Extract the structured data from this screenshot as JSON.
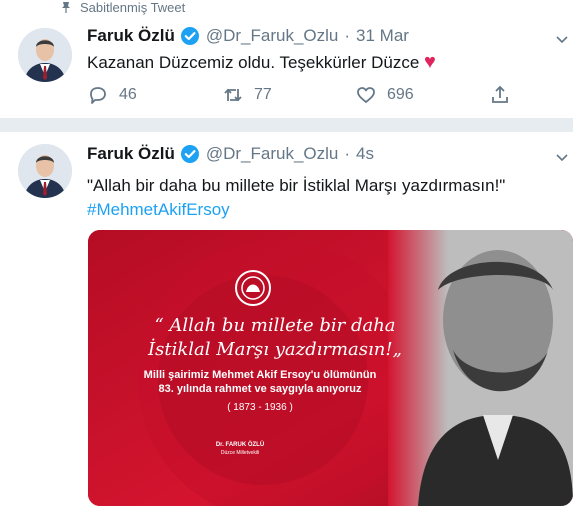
{
  "pinned": {
    "label": "Sabitlenmiş Tweet",
    "icon": "pin-icon"
  },
  "tweets": [
    {
      "name": "Faruk Özlü",
      "handle": "@Dr_Faruk_Ozlu",
      "separator": "·",
      "time": "31 Mar",
      "text": "Kazanan Düzcemiz oldu. Teşekkürler Düzce",
      "emoji": "♥",
      "replies": "46",
      "retweets": "77",
      "likes": "696"
    },
    {
      "name": "Faruk Özlü",
      "handle": "@Dr_Faruk_Ozlu",
      "separator": "·",
      "time": "4s",
      "text_line1": "\"Allah bir daha bu millete bir İstiklal Marşı yazdırmasın!\"",
      "hashtag": "#MehmetAkifErsoy",
      "media": {
        "quote_line1": "“ Allah bu millete bir daha",
        "quote_line2": "İstiklal Marşı yazdırmasın!„",
        "memorial_line1": "Milli şairimiz Mehmet Akif Ersoy'u ölümünün",
        "memorial_line2": "83. yılında rahmet ve saygıyla anıyoruz",
        "years": "( 1873 - 1936 )",
        "signature_name": "Dr. FARUK ÖZLÜ",
        "signature_title": "Düzce Milletvekili"
      }
    }
  ],
  "colors": {
    "accent": "#1da1f2",
    "muted": "#657786",
    "like": "#e0245e",
    "poster_red": "#c8102e"
  }
}
